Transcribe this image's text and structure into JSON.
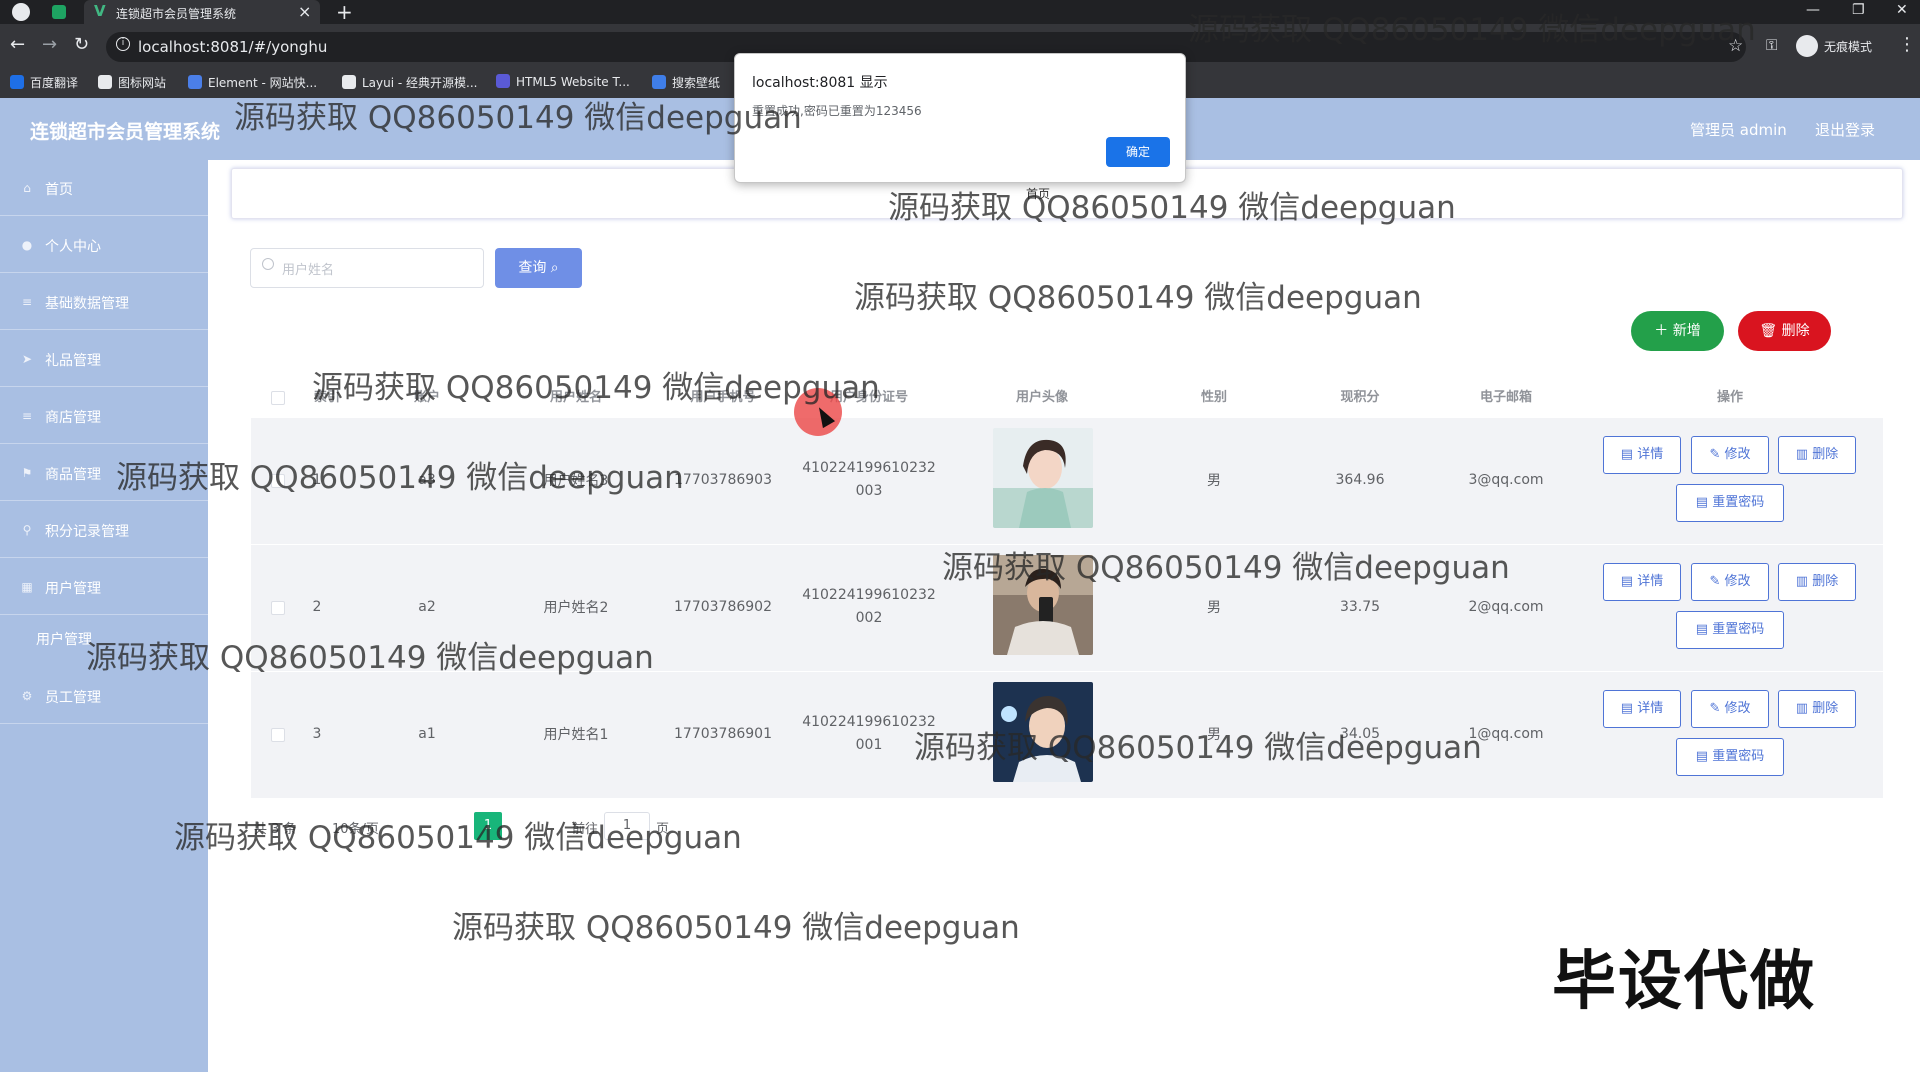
{
  "browser": {
    "tab_title": "连锁超市会员管理系统",
    "url": "localhost:8081/#/yonghu",
    "incognito_label": "无痕模式",
    "bookmarks": [
      "百度翻译",
      "图标网站",
      "Element - 网站快...",
      "Layui - 经典开源模...",
      "HTML5 Website T...",
      "搜索壁纸"
    ],
    "bookmark_colors": [
      "#1e6fe6",
      "#e8eaed",
      "#4b7fe8",
      "#e8eaed",
      "#5a5ad6",
      "#3f7ee8"
    ]
  },
  "header": {
    "title": "连锁超市会员管理系统",
    "admin_label": "管理员 admin",
    "logout_label": "退出登录"
  },
  "sidebar": {
    "items": [
      {
        "label": "首页",
        "icon": "home-icon"
      },
      {
        "label": "个人中心",
        "icon": "user-icon"
      },
      {
        "label": "基础数据管理",
        "icon": "list-icon"
      },
      {
        "label": "礼品管理",
        "icon": "send-icon"
      },
      {
        "label": "商店管理",
        "icon": "list-icon"
      },
      {
        "label": "商品管理",
        "icon": "flag-icon"
      },
      {
        "label": "积分记录管理",
        "icon": "pin-icon"
      },
      {
        "label": "用户管理",
        "icon": "grid-icon"
      }
    ],
    "sub_item": "用户管理",
    "last_item": {
      "label": "员工管理",
      "icon": "settings-icon"
    }
  },
  "breadcrumb": {
    "home": "首页"
  },
  "search": {
    "placeholder": "用户姓名",
    "query_label": "查询"
  },
  "actions": {
    "add_label": "新增",
    "delete_label": "删除"
  },
  "table": {
    "columns": [
      "索引",
      "账户",
      "用户姓名",
      "用户手机号",
      "用户身份证号",
      "用户头像",
      "性别",
      "现积分",
      "电子邮箱",
      "操作"
    ],
    "rows": [
      {
        "index": "1",
        "account": "a3",
        "name": "用户姓名3",
        "phone": "17703786903",
        "idcard_line1": "410224199610232",
        "idcard_line2": "003",
        "gender": "男",
        "points": "364.96",
        "email": "3@qq.com"
      },
      {
        "index": "2",
        "account": "a2",
        "name": "用户姓名2",
        "phone": "17703786902",
        "idcard_line1": "410224199610232",
        "idcard_line2": "002",
        "gender": "男",
        "points": "33.75",
        "email": "2@qq.com"
      },
      {
        "index": "3",
        "account": "a1",
        "name": "用户姓名1",
        "phone": "17703786901",
        "idcard_line1": "410224199610232",
        "idcard_line2": "001",
        "gender": "男",
        "points": "34.05",
        "email": "1@qq.com"
      }
    ],
    "row_actions": {
      "detail": "详情",
      "edit": "修改",
      "delete": "删除",
      "reset_password": "重置密码"
    }
  },
  "pagination": {
    "total_text": "共 3 条",
    "page_size_text": "10条/页",
    "current_page": "1",
    "goto_label": "前往",
    "goto_value": "1",
    "page_unit": "页"
  },
  "dialog": {
    "title": "localhost:8081 显示",
    "message": "重置成功,密码已重置为123456",
    "ok_label": "确定"
  },
  "overlays": {
    "watermark_text": "源码获取 QQ86050149 微信deepguan",
    "corner_text": "毕设代做"
  },
  "colors": {
    "header_bg": "#a9bfe3",
    "primary": "#6f8fe6",
    "success": "#23a04a",
    "danger": "#d9141f",
    "pager_active": "#18b57a",
    "dialog_button": "#1a73e8"
  }
}
